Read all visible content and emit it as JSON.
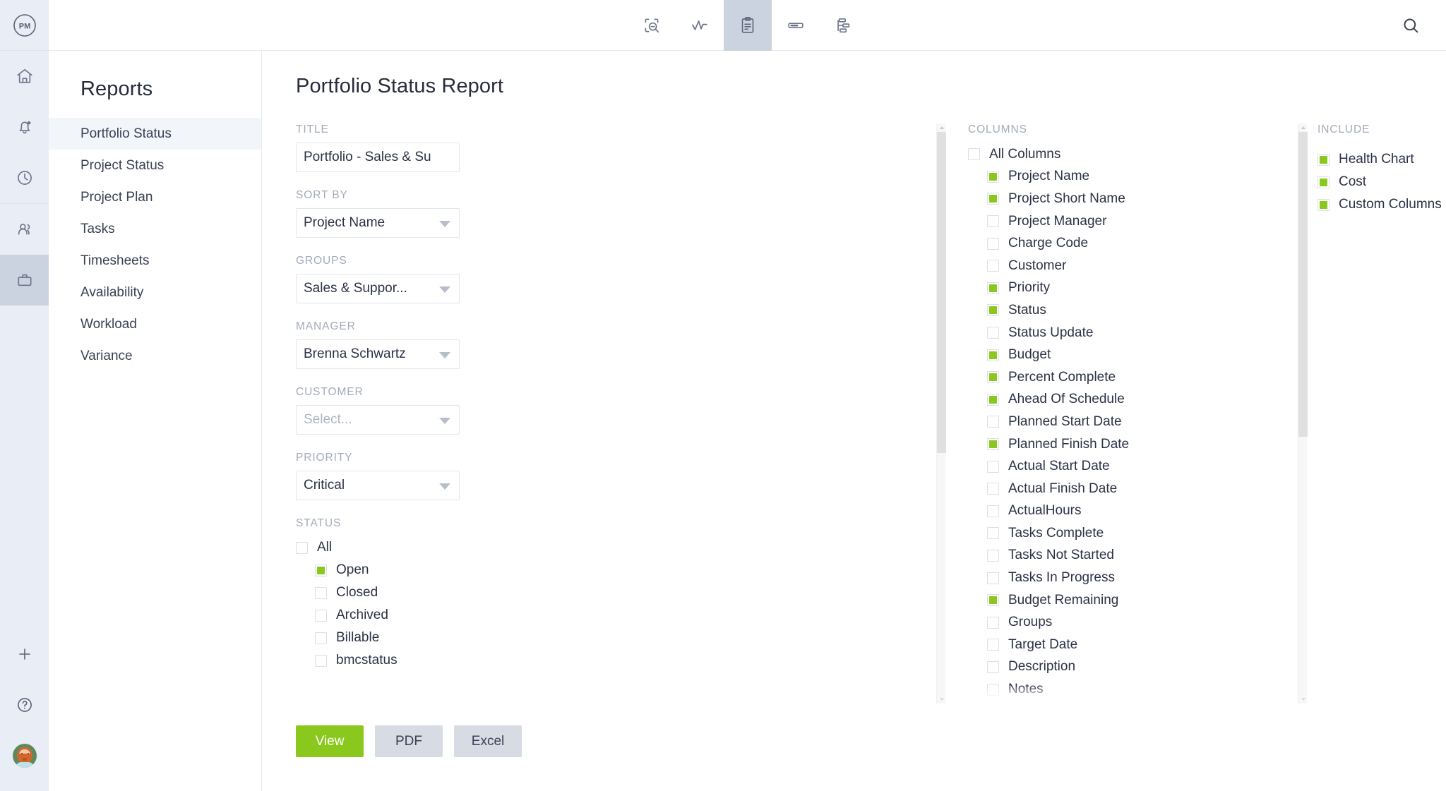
{
  "brand": {
    "logo_text": "PM",
    "accent_green": "#8ac81e",
    "rail_bg": "#e9edf5",
    "active_bg": "#ccd3e0"
  },
  "rail": {
    "items": [
      {
        "name": "home-icon",
        "label": "Home",
        "active": false
      },
      {
        "name": "notifications-bell-icon",
        "label": "Notifications",
        "active": false
      },
      {
        "name": "clock-icon",
        "label": "Time",
        "active": false
      },
      {
        "name": "people-icon",
        "label": "Team",
        "active": false
      },
      {
        "name": "briefcase-icon",
        "label": "Projects",
        "active": true
      }
    ],
    "bottom": [
      {
        "name": "plus-icon",
        "label": "Add"
      },
      {
        "name": "help-circle-icon",
        "label": "Help"
      },
      {
        "name": "avatar",
        "label": "User Profile"
      }
    ]
  },
  "topbar": {
    "tabs": [
      {
        "name": "zoom-select-icon",
        "label": "Overview",
        "active": false
      },
      {
        "name": "activity-pulse-icon",
        "label": "Activity",
        "active": false
      },
      {
        "name": "clipboard-icon",
        "label": "Reports",
        "active": true
      },
      {
        "name": "card-icon",
        "label": "Board",
        "active": false
      },
      {
        "name": "hierarchy-icon",
        "label": "Structure",
        "active": false
      }
    ],
    "search_label": "Search"
  },
  "sidebar": {
    "title": "Reports",
    "items": [
      {
        "label": "Portfolio Status",
        "active": true
      },
      {
        "label": "Project Status",
        "active": false
      },
      {
        "label": "Project Plan",
        "active": false
      },
      {
        "label": "Tasks",
        "active": false
      },
      {
        "label": "Timesheets",
        "active": false
      },
      {
        "label": "Availability",
        "active": false
      },
      {
        "label": "Workload",
        "active": false
      },
      {
        "label": "Variance",
        "active": false
      }
    ]
  },
  "page": {
    "title": "Portfolio Status Report"
  },
  "form": {
    "title": {
      "label": "Title",
      "value": "Portfolio - Sales & Su",
      "placeholder": ""
    },
    "sort_by": {
      "label": "Sort By",
      "value": "Project Name"
    },
    "groups": {
      "label": "Groups",
      "value": "Sales & Suppor..."
    },
    "manager": {
      "label": "Manager",
      "value": "Brenna Schwartz"
    },
    "customer": {
      "label": "Customer",
      "value": "Select...",
      "is_placeholder": true
    },
    "priority": {
      "label": "Priority",
      "value": "Critical"
    },
    "status": {
      "label": "Status",
      "all": {
        "label": "All",
        "checked": false
      },
      "options": [
        {
          "label": "Open",
          "checked": true
        },
        {
          "label": "Closed",
          "checked": false
        },
        {
          "label": "Archived",
          "checked": false
        },
        {
          "label": "Billable",
          "checked": false
        },
        {
          "label": "bmcstatus",
          "checked": false
        }
      ]
    }
  },
  "columns": {
    "label": "Columns",
    "all": {
      "label": "All Columns",
      "checked": false
    },
    "options": [
      {
        "label": "Project Name",
        "checked": true
      },
      {
        "label": "Project Short Name",
        "checked": true
      },
      {
        "label": "Project Manager",
        "checked": false
      },
      {
        "label": "Charge Code",
        "checked": false
      },
      {
        "label": "Customer",
        "checked": false
      },
      {
        "label": "Priority",
        "checked": true
      },
      {
        "label": "Status",
        "checked": true
      },
      {
        "label": "Status Update",
        "checked": false
      },
      {
        "label": "Budget",
        "checked": true
      },
      {
        "label": "Percent Complete",
        "checked": true
      },
      {
        "label": "Ahead Of Schedule",
        "checked": true
      },
      {
        "label": "Planned Start Date",
        "checked": false
      },
      {
        "label": "Planned Finish Date",
        "checked": true
      },
      {
        "label": "Actual Start Date",
        "checked": false
      },
      {
        "label": "Actual Finish Date",
        "checked": false
      },
      {
        "label": "ActualHours",
        "checked": false
      },
      {
        "label": "Tasks Complete",
        "checked": false
      },
      {
        "label": "Tasks Not Started",
        "checked": false
      },
      {
        "label": "Tasks In Progress",
        "checked": false
      },
      {
        "label": "Budget Remaining",
        "checked": true
      },
      {
        "label": "Groups",
        "checked": false
      },
      {
        "label": "Target Date",
        "checked": false
      },
      {
        "label": "Description",
        "checked": false
      },
      {
        "label": "Notes",
        "checked": false
      }
    ]
  },
  "include": {
    "label": "Include",
    "options": [
      {
        "label": "Health Chart",
        "checked": true
      },
      {
        "label": "Cost",
        "checked": true
      },
      {
        "label": "Custom Columns",
        "checked": true
      }
    ]
  },
  "actions": {
    "view": "View",
    "pdf": "PDF",
    "excel": "Excel"
  }
}
